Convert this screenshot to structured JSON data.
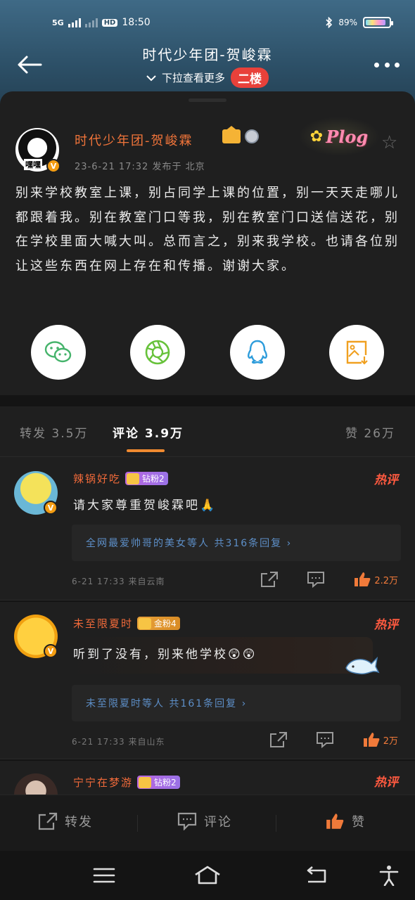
{
  "status_bar": {
    "network": "5G",
    "time": "18:50",
    "battery": "89%",
    "battery_level": 0.89
  },
  "nav": {
    "title": "时代少年团-贺峻霖",
    "pull_hint": "下拉查看更多",
    "floor_badge": "二楼"
  },
  "post": {
    "author_name": "时代少年团-贺峻霖",
    "avatar_caption": "嘿嘿",
    "verified_mark": "V",
    "meta": "23-6-21 17:32  发布于 北京",
    "sticker_text": "Plog",
    "body": "别来学校教室上课，别占同学上课的位置，别一天天走哪儿都跟着我。别在教室门口等我，别在教室门口送信送花，别在学校里面大喊大叫。总而言之，别来我学校。也请各位别让这些东西在网上存在和传播。谢谢大家。"
  },
  "share_targets": [
    {
      "name": "wechat-icon",
      "color": "#45b36b"
    },
    {
      "name": "moments-icon",
      "color": "#67c23a"
    },
    {
      "name": "qq-icon",
      "color": "#2d9cdb"
    },
    {
      "name": "save-image-icon",
      "color": "#f0a020"
    }
  ],
  "tabs": {
    "repost": "转发 3.5万",
    "comment": "评论 3.9万",
    "like": "赞 26万"
  },
  "comments": [
    {
      "name": "辣锅好吃",
      "badge": "钻粉2",
      "hot": "热评",
      "text": "请大家尊重贺峻霖吧",
      "emoji": "🙏",
      "replies": "全网最爱帅哥的美女等人 共316条回复",
      "meta": "6-21 17:33  来自云南",
      "likes": "2.2万"
    },
    {
      "name": "未至限夏时",
      "badge": "金粉4",
      "hot": "热评",
      "text": "听到了没有，别来他学校",
      "emoji": "😲😲",
      "replies": "未至限夏时等人 共161条回复",
      "meta": "6-21 17:33  来自山东",
      "likes": "2万"
    },
    {
      "name": "宁宁在梦游",
      "badge": "钻粉2",
      "hot": "热评"
    }
  ],
  "bottom_bar": {
    "repost": "转发",
    "comment": "评论",
    "like": "赞"
  },
  "colors": {
    "accent": "#f08a30",
    "name_orange": "#f06a3a",
    "reply_link": "#5d8fc8",
    "floor_badge": "#e8413a"
  }
}
